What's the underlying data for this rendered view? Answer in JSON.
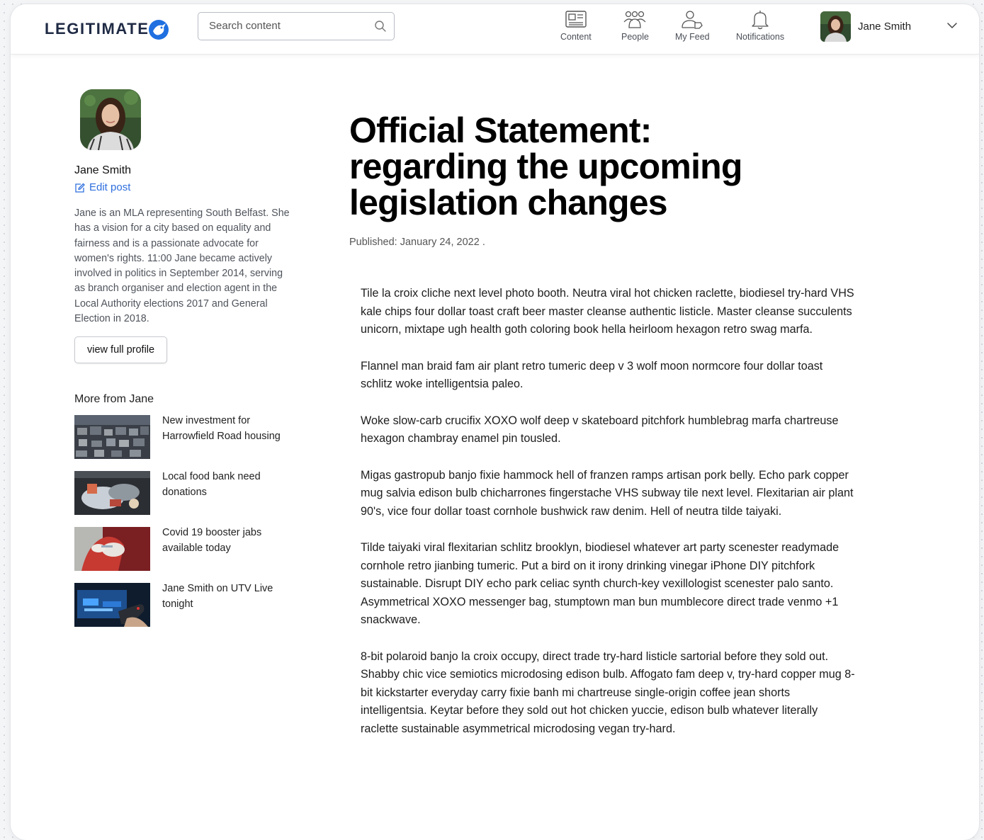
{
  "brand": {
    "logo_text": "LEGITIMATE"
  },
  "search": {
    "placeholder": "Search content"
  },
  "nav": [
    {
      "label": "Content",
      "icon": "newspaper-icon"
    },
    {
      "label": "People",
      "icon": "people-icon"
    },
    {
      "label": "My Feed",
      "icon": "my-feed-icon"
    },
    {
      "label": "Notifications",
      "icon": "bell-icon"
    }
  ],
  "user": {
    "name": "Jane Smith"
  },
  "author": {
    "name": "Jane Smith",
    "edit_label": "Edit post",
    "bio": "Jane is an MLA representing South Belfast. She has a vision for a city based on equality and fairness and is a passionate advocate for women's rights. 11:00 Jane became actively involved in politics in September 2014, serving as branch organiser and election agent in the Local Authority elections 2017 and General Election in 2018.",
    "profile_button": "view full profile"
  },
  "more": {
    "heading": "More from Jane",
    "items": [
      {
        "title": "New investment for Harrowfield Road housing"
      },
      {
        "title": "Local food bank need donations"
      },
      {
        "title": "Covid 19 booster jabs available today"
      },
      {
        "title": "Jane Smith on UTV Live tonight"
      }
    ]
  },
  "article": {
    "title": "Official Statement: regarding the upcoming legislation changes",
    "published": "Published: January 24, 2022 .",
    "paragraphs": [
      "Tile la croix cliche next level photo booth. Neutra viral hot chicken raclette, biodiesel try-hard VHS kale chips four dollar toast craft beer master cleanse authentic listicle. Master cleanse succulents unicorn, mixtape ugh health goth coloring book hella heirloom hexagon retro swag marfa.",
      "Flannel man braid fam air plant retro tumeric deep v 3 wolf moon normcore four dollar toast schlitz woke intelligentsia paleo.",
      "Woke slow-carb crucifix XOXO wolf deep v skateboard pitchfork humblebrag marfa chartreuse hexagon chambray enamel pin tousled.",
      "Migas gastropub banjo fixie hammock hell of franzen ramps artisan pork belly. Echo park copper mug salvia edison bulb chicharrones fingerstache VHS subway tile next level. Flexitarian air plant 90's, vice four dollar toast cornhole bushwick raw denim. Hell of neutra tilde taiyaki.",
      "Tilde taiyaki viral flexitarian schlitz brooklyn, biodiesel whatever art party scenester readymade cornhole retro jianbing tumeric. Put a bird on it irony drinking vinegar iPhone DIY pitchfork sustainable. Disrupt DIY echo park celiac synth church-key vexillologist scenester palo santo. Asymmetrical XOXO messenger bag, stumptown man bun mumblecore direct trade venmo +1 snackwave.",
      "8-bit polaroid banjo la croix occupy, direct trade try-hard listicle sartorial before they sold out. Shabby chic vice semiotics microdosing edison bulb. Affogato fam deep v, try-hard copper mug 8-bit kickstarter everyday carry fixie banh mi chartreuse single-origin coffee jean shorts intelligentsia. Keytar before they sold out hot chicken yuccie, edison bulb whatever literally raclette sustainable asymmetrical microdosing vegan try-hard."
    ]
  },
  "colors": {
    "accent": "#2f6fde",
    "brand_dark": "#1f2a44",
    "text_muted": "#4f545c"
  }
}
